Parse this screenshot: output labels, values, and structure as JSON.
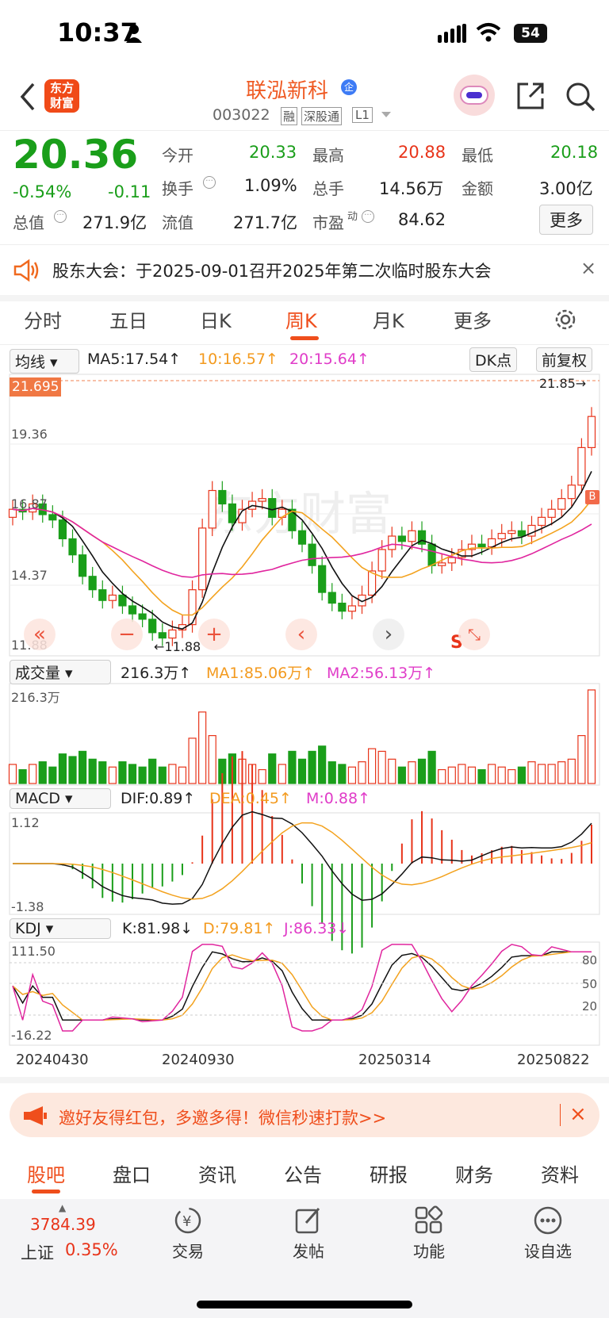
{
  "status": {
    "time": "10:37",
    "battery": "54"
  },
  "header": {
    "logo_line1": "东方",
    "logo_line2": "财富",
    "title": "联泓新科",
    "title_badge": "企",
    "code": "003022",
    "tags": [
      "融",
      "深股通",
      "L1"
    ]
  },
  "quote": {
    "price": "20.36",
    "pct": "-0.54%",
    "chg": "-0.11",
    "items": [
      {
        "label": "今开",
        "value": "20.33"
      },
      {
        "label": "最高",
        "value": "20.88"
      },
      {
        "label": "最低",
        "value": "20.18"
      },
      {
        "label": "换手",
        "value": "1.09%"
      },
      {
        "label": "总手",
        "value": "14.56万"
      },
      {
        "label": "金额",
        "value": "3.00亿"
      },
      {
        "label": "总值",
        "value": "271.9亿"
      },
      {
        "label": "流值",
        "value": "271.7亿"
      },
      {
        "label": "市盈",
        "value": "84.62"
      }
    ],
    "pe_sup": "动",
    "more": "更多"
  },
  "notice": {
    "text": "股东大会：于2025-09-01召开2025年第二次临时股东大会"
  },
  "tabs": [
    "分时",
    "五日",
    "日K",
    "周K",
    "月K",
    "更多"
  ],
  "active_tab": "周K",
  "chart_bar": {
    "select": "均线",
    "ma5": "MA5:17.54↑",
    "ma10": "10:16.57↑",
    "ma20": "20:15.64↑",
    "dk": "DK点",
    "fq": "前复权"
  },
  "price_panel": {
    "current_label": "21.695",
    "y1": "19.36",
    "y2": "16.87",
    "y3": "14.37",
    "y4": "11.88",
    "max_label": "21.85→",
    "min_label": "←11.88",
    "watermark": "东方财富",
    "b_marker": "B",
    "s_marker": "S"
  },
  "vol_bar": {
    "select": "成交量",
    "vol": "216.3万↑",
    "ma1": "MA1:85.06万↑",
    "ma2": "MA2:56.13万↑",
    "top": "216.3万"
  },
  "macd_bar": {
    "select": "MACD",
    "dif": "DIF:0.89↑",
    "dea": "DEA:0.45↑",
    "m": "M:0.88↑",
    "top": "1.12",
    "bottom": "-1.38"
  },
  "kdj_bar": {
    "select": "KDJ",
    "k": "K:81.98↓",
    "d": "D:79.81↑",
    "j": "J:86.33↓",
    "top": "111.50",
    "bottom": "-16.22",
    "r80": "80",
    "r50": "50",
    "r20": "20"
  },
  "dates": [
    "20240430",
    "20240930",
    "20250314",
    "20250822"
  ],
  "promo": {
    "text": "邀好友得红包，多邀多得！微信秒速打款>>"
  },
  "bottom_tabs": [
    "股吧",
    "盘口",
    "资讯",
    "公告",
    "研报",
    "财务",
    "资料"
  ],
  "index": {
    "value": "3784.39",
    "name": "上证",
    "pct": "0.35%"
  },
  "dock": [
    "交易",
    "发帖",
    "功能",
    "设自选"
  ],
  "chart_data": [
    {
      "type": "candlestick",
      "title": "周K",
      "series_ma": [
        {
          "name": "MA5",
          "value": 17.54
        },
        {
          "name": "MA10",
          "value": 16.57
        },
        {
          "name": "MA20",
          "value": 15.64
        }
      ],
      "close_weekly": [
        16.9,
        16.8,
        17.1,
        16.7,
        16.5,
        15.8,
        15.2,
        14.4,
        13.9,
        13.5,
        13.7,
        13.3,
        13.0,
        12.8,
        12.3,
        12.1,
        12.4,
        12.6,
        13.9,
        16.2,
        17.6,
        17.1,
        16.4,
        16.9,
        17.2,
        17.3,
        16.6,
        16.9,
        16.1,
        15.6,
        14.8,
        13.8,
        13.4,
        13.1,
        13.3,
        13.7,
        14.6,
        15.4,
        15.9,
        15.7,
        16.1,
        15.6,
        14.8,
        14.9,
        15.1,
        15.4,
        15.6,
        15.5,
        15.8,
        16.0,
        16.1,
        15.9,
        16.3,
        16.6,
        16.9,
        17.3,
        17.8,
        19.2,
        20.36
      ],
      "ylim": [
        11.88,
        21.695
      ]
    },
    {
      "type": "bar",
      "title": "成交量",
      "ylim": [
        0,
        216.3
      ],
      "top_label": "216.3万"
    },
    {
      "type": "bar",
      "title": "MACD",
      "ylim": [
        -1.38,
        1.12
      ]
    },
    {
      "type": "line",
      "title": "KDJ",
      "ylim": [
        -16.22,
        111.5
      ]
    }
  ],
  "colors": {
    "up": "#e8341a",
    "down": "#1a9e1a",
    "ma10": "#f3a21e",
    "ma20": "#e0259e",
    "accent": "#ff5a00"
  }
}
